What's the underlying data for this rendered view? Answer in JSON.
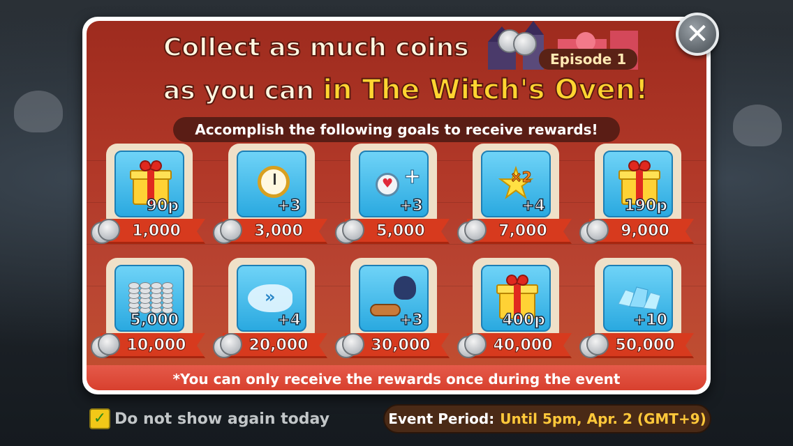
{
  "popup": {
    "title_line1": "Collect as much coins",
    "title_line2_prefix": "as you can ",
    "title_line2_highlight": "in The Witch's Oven!",
    "episode": "Episode 1",
    "subtitle": "Accomplish the following goals to receive rewards!",
    "close_symbol": "✕",
    "footer_note": "*You can only receive the rewards once during the event"
  },
  "rewards": [
    {
      "icon": "gift-icon",
      "label": "90p",
      "goal": "1,000"
    },
    {
      "icon": "stopwatch-icon",
      "label": "+3",
      "goal": "3,000"
    },
    {
      "icon": "potion-icon",
      "label": "+3",
      "goal": "5,000"
    },
    {
      "icon": "star-x2-icon",
      "label": "+4",
      "goal": "7,000"
    },
    {
      "icon": "gift-icon",
      "label": "190p",
      "goal": "9,000"
    },
    {
      "icon": "coin-stack-icon",
      "label": "5,000",
      "goal": "10,000"
    },
    {
      "icon": "dash-icon",
      "label": "+4",
      "goal": "20,000"
    },
    {
      "icon": "ninja-cookie-icon",
      "label": "+3",
      "goal": "30,000"
    },
    {
      "icon": "gift-icon",
      "label": "400p",
      "goal": "40,000"
    },
    {
      "icon": "crystal-icon",
      "label": "+10",
      "goal": "50,000"
    }
  ],
  "star_overlay": "×2",
  "dash_glyph": "»",
  "bottom": {
    "checkbox_checked": true,
    "checkbox_mark": "✓",
    "checkbox_label": "Do not show again today",
    "event_label": "Event Period:",
    "event_value": "Until 5pm, Apr. 2 (GMT+9)"
  },
  "colors": {
    "panel_red": "#b13828",
    "ribbon_red": "#d73a1e",
    "highlight_yellow": "#ffd531",
    "icon_blue": "#2aa9e0"
  }
}
